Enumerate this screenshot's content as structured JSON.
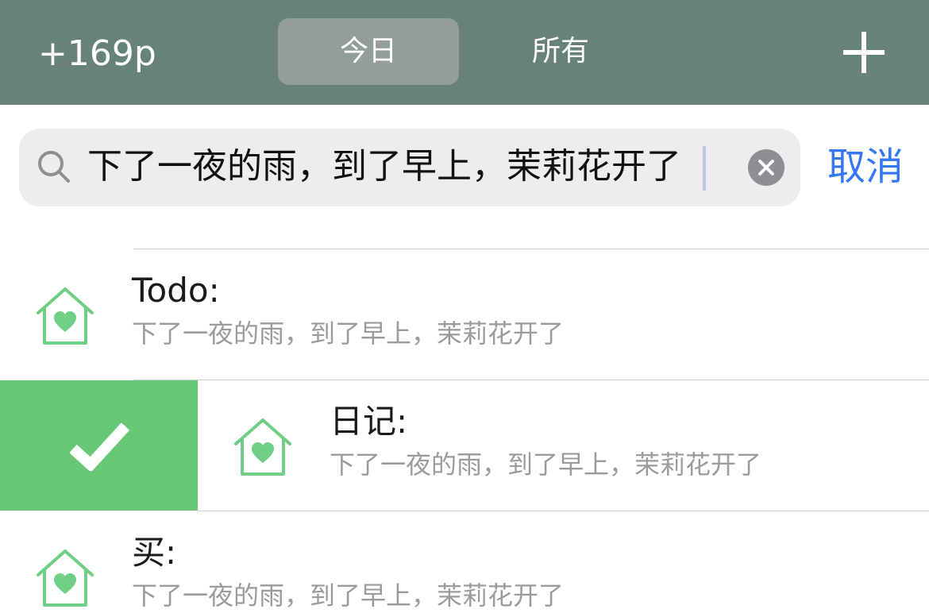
{
  "header": {
    "points": "+169p",
    "tabs": [
      {
        "label": "今日",
        "selected": true
      },
      {
        "label": "所有",
        "selected": false
      }
    ],
    "add_icon": "plus-icon"
  },
  "search": {
    "query": "下了一夜的雨，到了早上，茉莉花开了",
    "search_icon": "magnifier-icon",
    "clear_icon": "clear-icon",
    "cancel_label": "取消"
  },
  "list": {
    "items": [
      {
        "title": "Todo:",
        "subtitle": "下了一夜的雨，到了早上，茉莉花开了",
        "icon": "house-heart-icon"
      },
      {
        "title": "日记:",
        "subtitle": "下了一夜的雨，到了早上，茉莉花开了",
        "icon": "house-heart-icon",
        "swiped": true
      },
      {
        "title": "买:",
        "subtitle": "下了一夜的雨，到了早上，茉莉花开了",
        "icon": "house-heart-icon"
      }
    ],
    "swipe_action_icon": "checkmark-icon"
  },
  "colors": {
    "header_bg": "#678378",
    "accent_green": "#66c876",
    "link_blue": "#3478f6"
  }
}
